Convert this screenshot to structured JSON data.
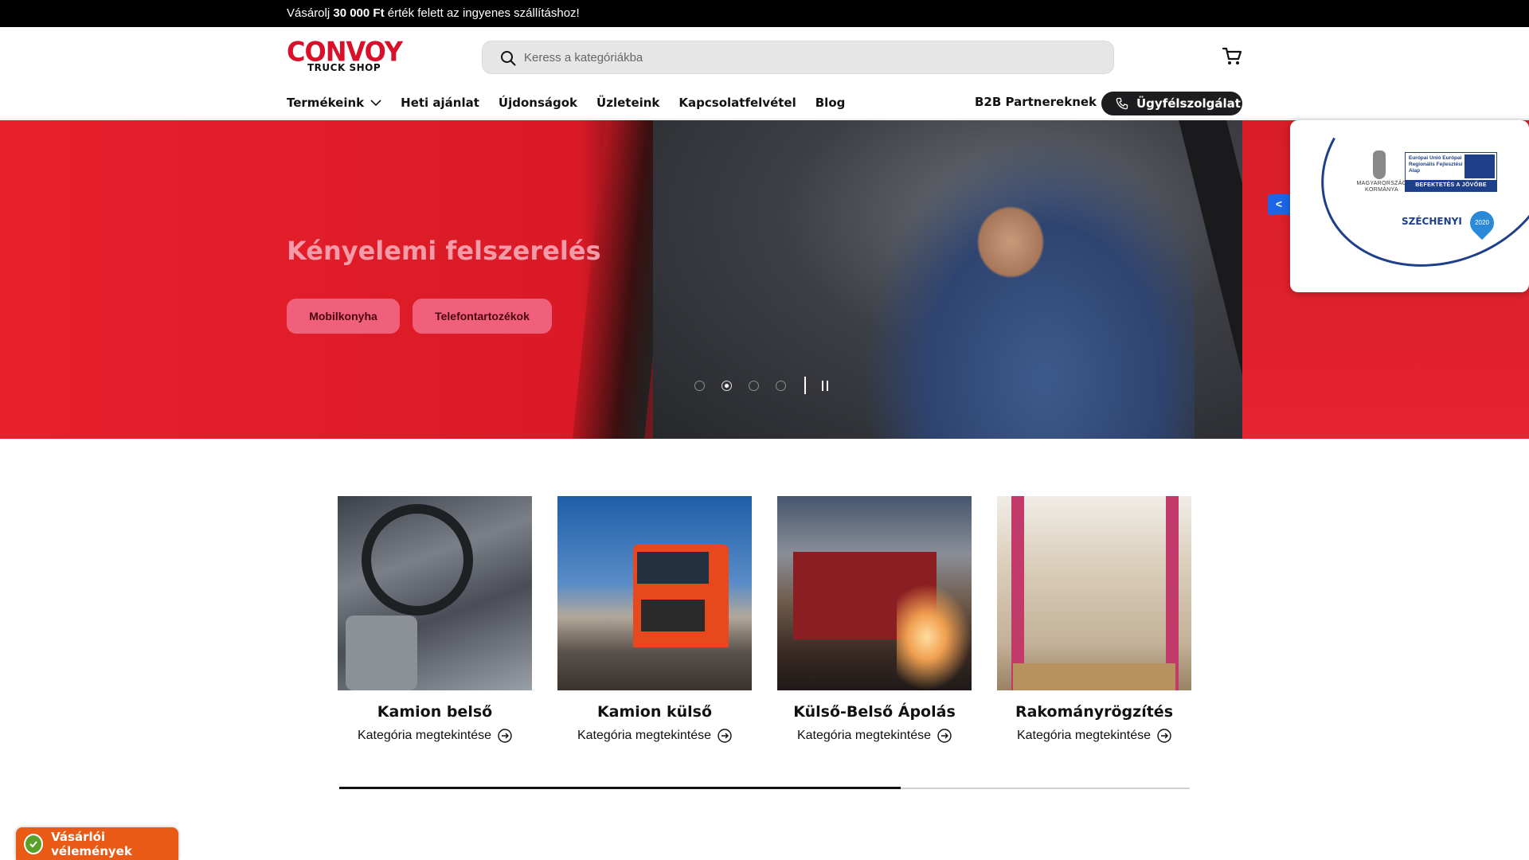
{
  "announcement": {
    "prefix": "Vásárolj ",
    "amount": "30 000 Ft",
    "suffix": " érték felett az ingyenes szállításhoz!"
  },
  "logo": {
    "line1": "CONVOY",
    "line2": "TRUCK SHOP"
  },
  "search": {
    "placeholder": "Keress a kategóriákba"
  },
  "nav": {
    "items": [
      {
        "label": "Termékeink"
      },
      {
        "label": "Heti ajánlat"
      },
      {
        "label": "Újdonságok"
      },
      {
        "label": "Üzleteink"
      },
      {
        "label": "Kapcsolatfelvétel"
      },
      {
        "label": "Blog"
      }
    ],
    "b2b_label": "B2B Partnereknek",
    "support_label": "Ügyfélszolgálat"
  },
  "hero": {
    "title": "Kényelemi felszerelés",
    "buttons": [
      "Mobilkonyha",
      "Telefontartozékok"
    ],
    "slide_count": 4,
    "active_slide": 2
  },
  "badge": {
    "tab_label": "<",
    "gov_text": "MAGYARORSZÁG KORMÁNYA",
    "eu_text": "Európai Unió Európai Regionális Fejlesztési Alap",
    "eu_bar": "BEFEKTETÉS A JÖVŐBE",
    "szechenyi": "SZÉCHENYI",
    "year": "2020"
  },
  "categories": [
    {
      "title": "Kamion belső",
      "link": "Kategória megtekintése"
    },
    {
      "title": "Kamion külső",
      "link": "Kategória megtekintése"
    },
    {
      "title": "Külső-Belső Ápolás",
      "link": "Kategória megtekintése"
    },
    {
      "title": "Rakományrögzítés",
      "link": "Kategória megtekintése"
    }
  ],
  "carousel_progress": 0.66,
  "reviews_widget": {
    "label": "Vásárlói vélemények"
  },
  "colors": {
    "brand": "#d8102a",
    "accent_pink": "#f0607a",
    "badge_blue": "#1e3f8a",
    "reviews_orange": "#e85a16"
  }
}
